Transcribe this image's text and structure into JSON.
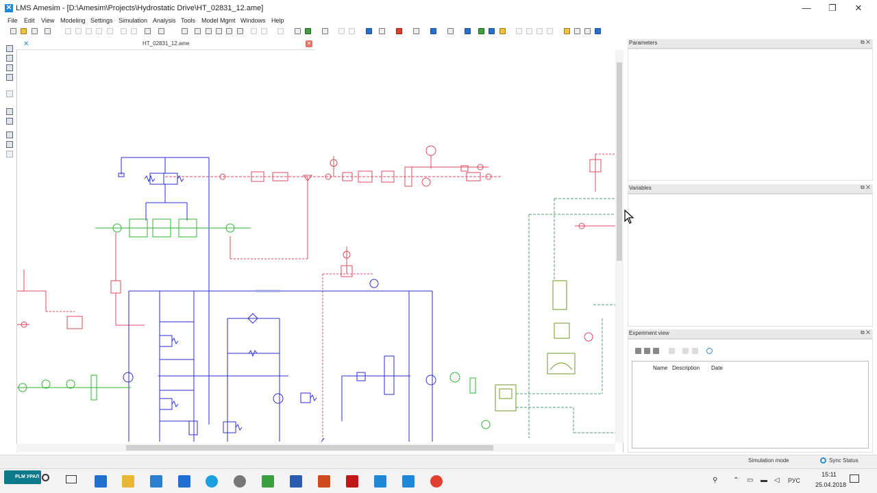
{
  "window": {
    "app_icon": "amesim-logo-icon",
    "title": "LMS Amesim - [D:\\Amesim\\Projects\\Hydrostatic Drive\\HT_02831_12.ame]",
    "controls": [
      "—",
      "❐",
      "✕"
    ]
  },
  "menu": {
    "items": [
      "File",
      "Edit",
      "View",
      "Modeling",
      "Settings",
      "Simulation",
      "Analysis",
      "Tools",
      "Model Mgmt",
      "Windows",
      "Help"
    ]
  },
  "document": {
    "tab_label": "HT_02831_12.ame",
    "close_glyph": "✕"
  },
  "panels": {
    "parameters": "Parameters",
    "variables": "Variables",
    "experiment_view": "Experiment view",
    "btn_glyphs": "⧉ ✕"
  },
  "experiment_table": {
    "columns": [
      "Name",
      "Description",
      "Date"
    ]
  },
  "status": {
    "simulation_mode": "Simulation mode",
    "sync_status": "Sync Status"
  },
  "taskbar": {
    "start_label": "PLM УРАЛ",
    "language": "РУС",
    "time": "15:11",
    "date": "25.04.2018"
  },
  "colors": {
    "hydraulic_red": "#e0475a",
    "hydraulic_blue": "#2a2ad0",
    "hydraulic_green": "#2fb52f",
    "mechanical_olive": "#6f9a24",
    "accent": "#1e88d9"
  }
}
